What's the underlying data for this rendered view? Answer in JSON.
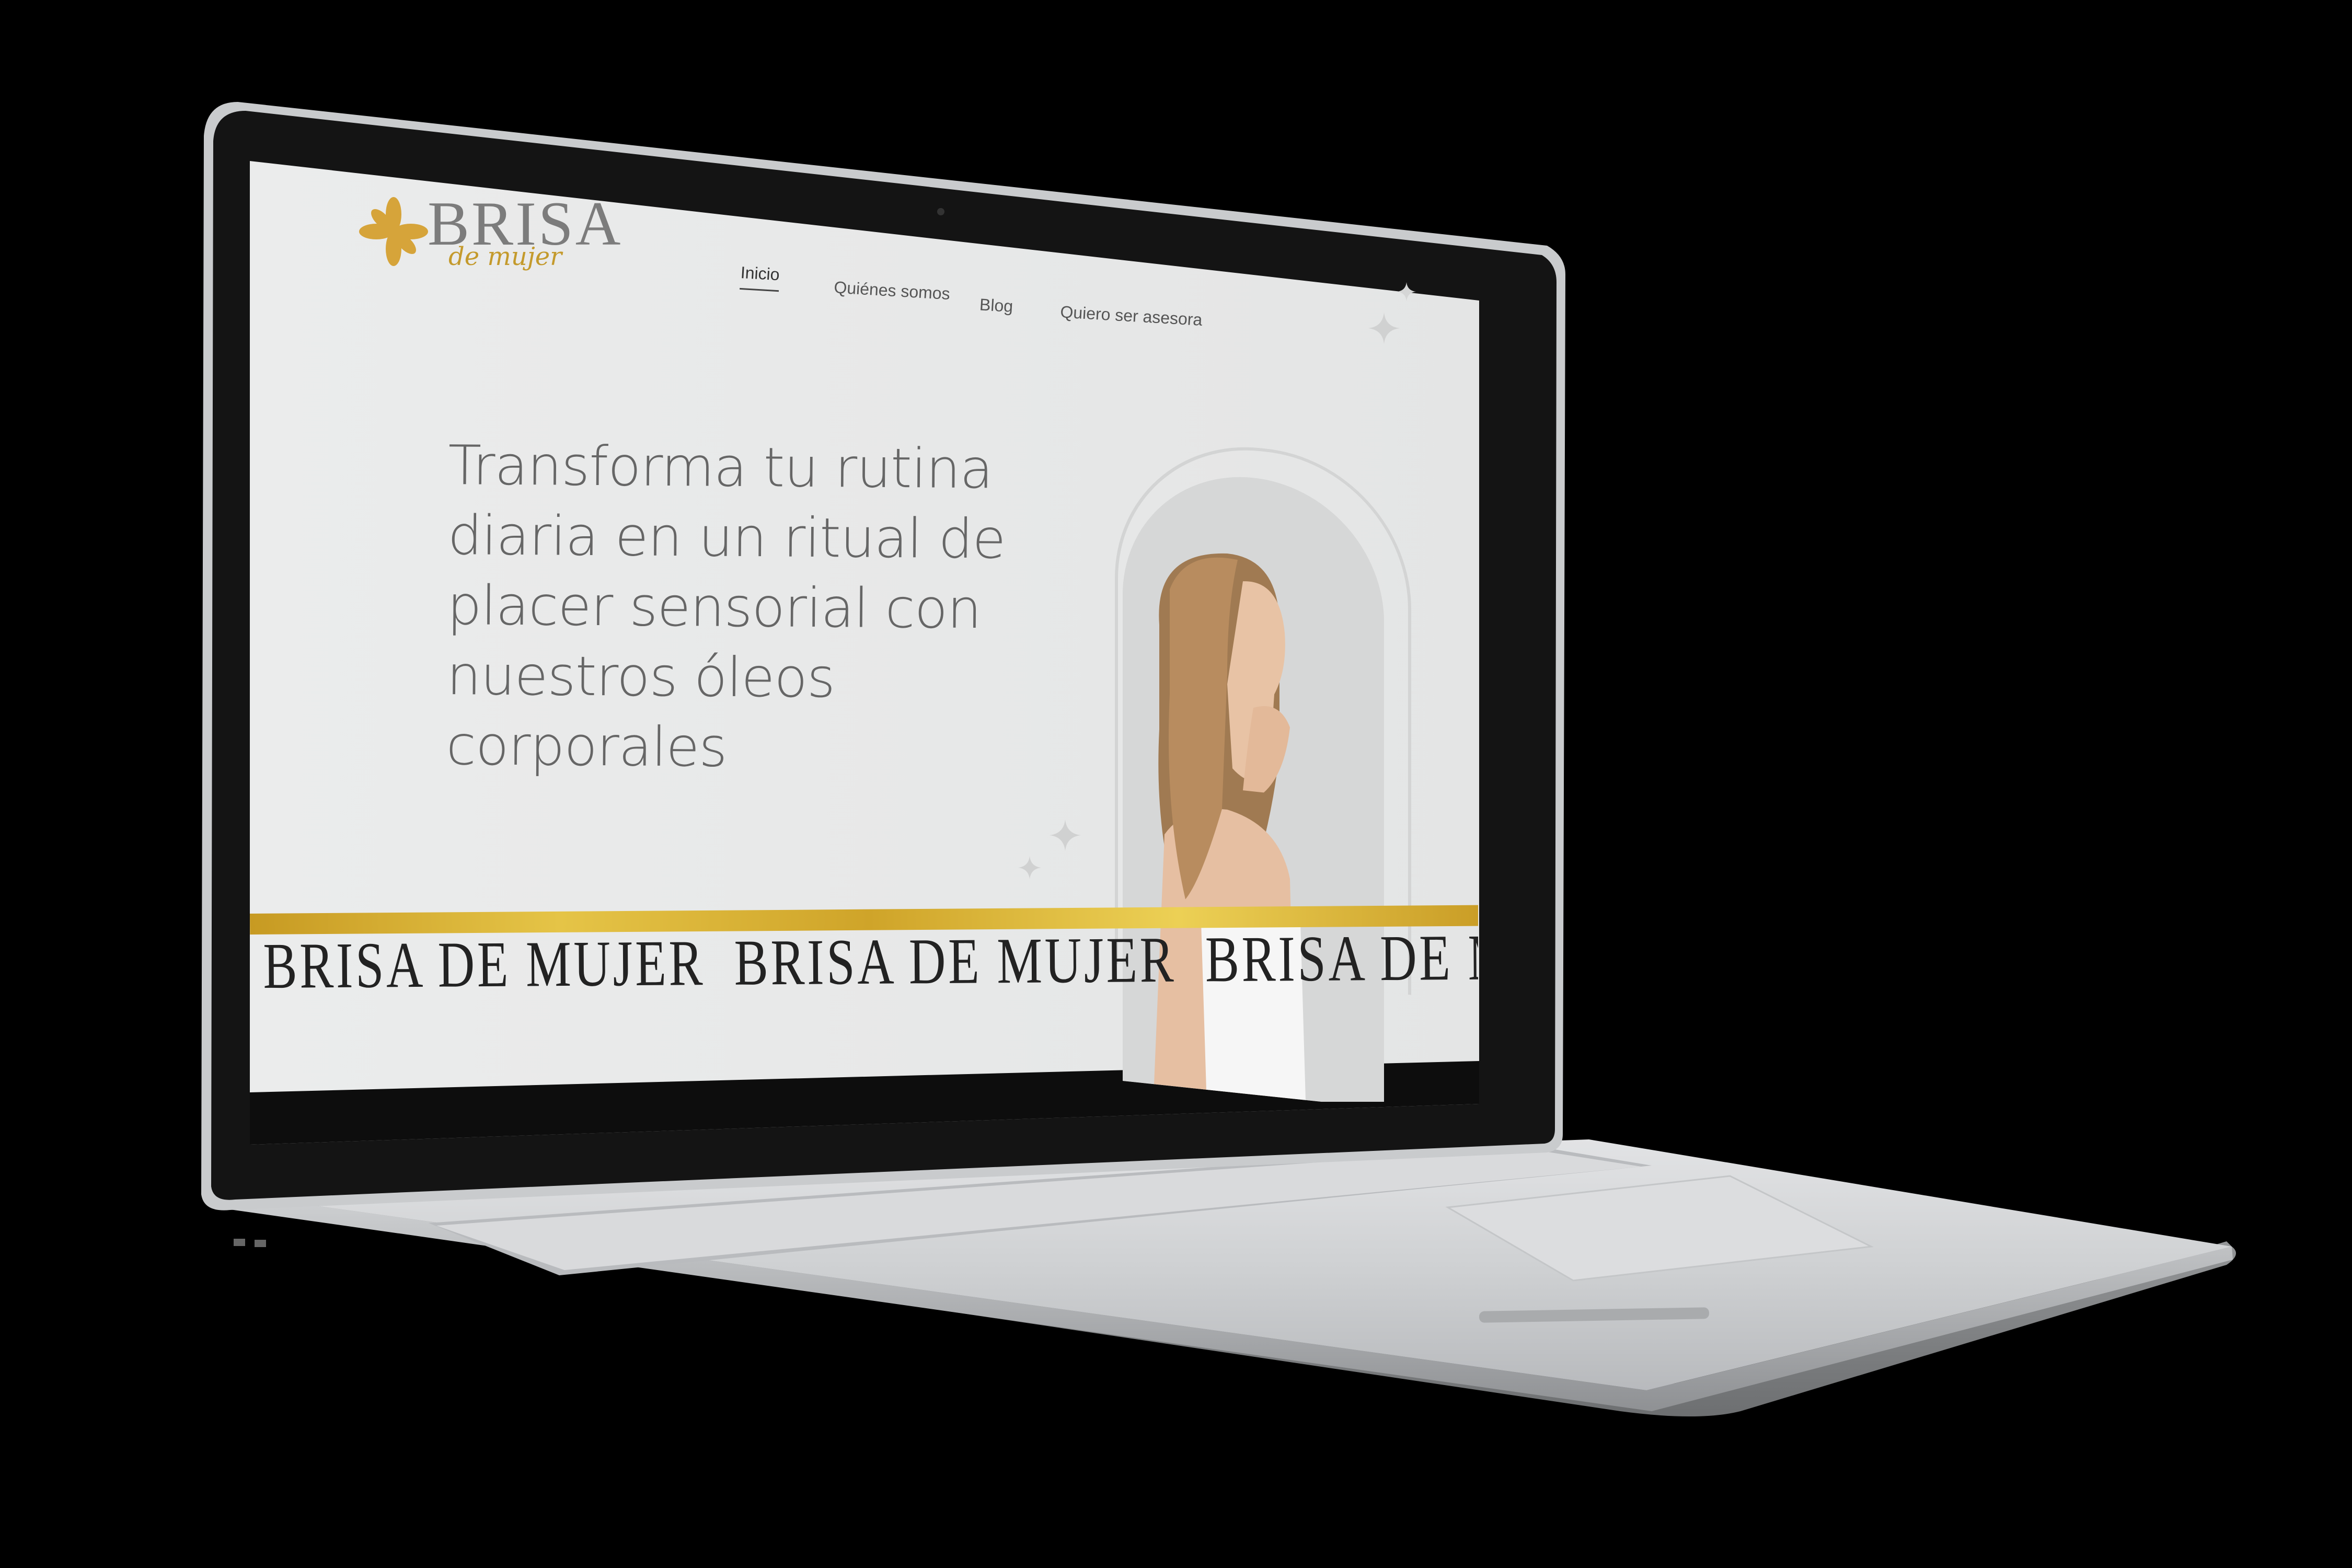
{
  "site": {
    "brand": "BRISA",
    "brand_script": "de mujer",
    "nav": [
      {
        "label": "Inicio",
        "active": true
      },
      {
        "label": "Quiénes somos",
        "active": false
      },
      {
        "label": "Blog",
        "active": false
      },
      {
        "label": "Quiero ser asesora",
        "active": false
      }
    ],
    "hero_lines": [
      "Transforma tu rutina",
      "diaria en un ritual de",
      "placer sensorial con",
      "nuestros óleos",
      "corporales"
    ],
    "marquee": [
      "BRISA DE MUJER",
      "BRISA DE MUJER",
      "BRISA DE MUJER"
    ]
  },
  "colors": {
    "page_bg": "#000000",
    "screen_bg": "#eaebeb",
    "gold": "#d4a82c",
    "heading_text": "#666666"
  }
}
